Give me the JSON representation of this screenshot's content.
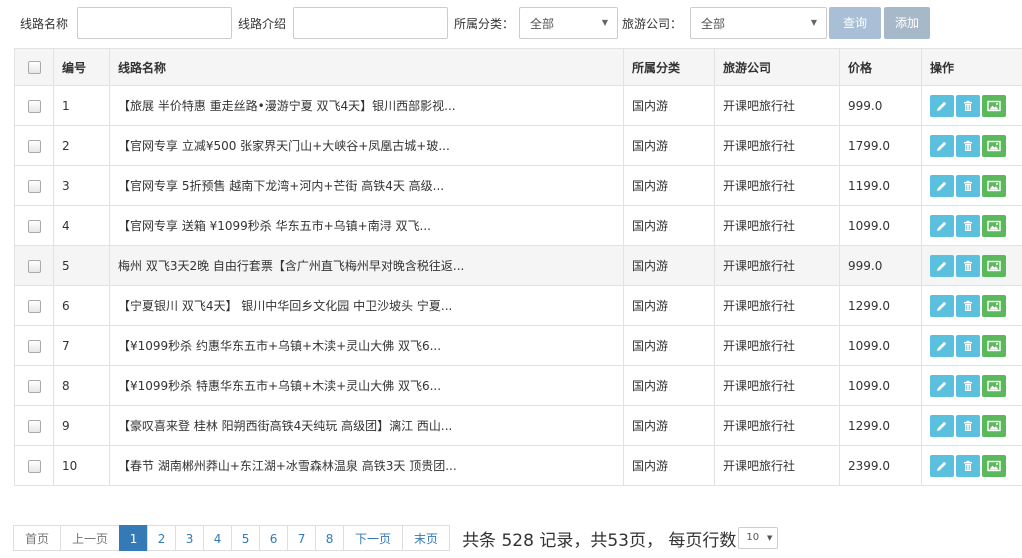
{
  "search": {
    "route_name_label": "线路名称",
    "route_name_value": "",
    "route_intro_label": "线路介绍",
    "route_intro_value": "",
    "category_label": "所属分类：",
    "category_selected": "全部",
    "company_label": "旅游公司：",
    "company_selected": "全部",
    "query_button": "查询",
    "add_button": "添加"
  },
  "table": {
    "headers": {
      "id": "编号",
      "name": "线路名称",
      "category": "所属分类",
      "company": "旅游公司",
      "price": "价格",
      "actions": "操作"
    },
    "highlighted_row": 5,
    "rows": [
      {
        "id": "1",
        "name": "【旅展 半价特惠 重走丝路•漫游宁夏 双飞4天】银川西部影视...",
        "category": "国内游",
        "company": "开课吧旅行社",
        "price": "999.0"
      },
      {
        "id": "2",
        "name": "【官网专享 立减¥500 张家界天门山+大峡谷+凤凰古城+玻...",
        "category": "国内游",
        "company": "开课吧旅行社",
        "price": "1799.0"
      },
      {
        "id": "3",
        "name": "【官网专享 5折预售 越南下龙湾+河内+芒街 高铁4天 高级...",
        "category": "国内游",
        "company": "开课吧旅行社",
        "price": "1199.0"
      },
      {
        "id": "4",
        "name": "【官网专享 送箱 ¥1099秒杀 华东五市+乌镇+南浔 双飞...",
        "category": "国内游",
        "company": "开课吧旅行社",
        "price": "1099.0"
      },
      {
        "id": "5",
        "name": "梅州 双飞3天2晚 自由行套票【含广州直飞梅州早对晚含税往返...",
        "category": "国内游",
        "company": "开课吧旅行社",
        "price": "999.0"
      },
      {
        "id": "6",
        "name": "【宁夏银川 双飞4天】 银川中华回乡文化园 中卫沙坡头 宁夏...",
        "category": "国内游",
        "company": "开课吧旅行社",
        "price": "1299.0"
      },
      {
        "id": "7",
        "name": "【¥1099秒杀 约惠华东五市+乌镇+木渎+灵山大佛 双飞6...",
        "category": "国内游",
        "company": "开课吧旅行社",
        "price": "1099.0"
      },
      {
        "id": "8",
        "name": "【¥1099秒杀 特惠华东五市+乌镇+木渎+灵山大佛 双飞6...",
        "category": "国内游",
        "company": "开课吧旅行社",
        "price": "1099.0"
      },
      {
        "id": "9",
        "name": "【豪叹喜来登 桂林 阳朔西街高铁4天纯玩 高级团】漓江 西山...",
        "category": "国内游",
        "company": "开课吧旅行社",
        "price": "1299.0"
      },
      {
        "id": "10",
        "name": "【春节 湖南郴州莽山+东江湖+冰雪森林温泉 高铁3天 顶贵团...",
        "category": "国内游",
        "company": "开课吧旅行社",
        "price": "2399.0"
      }
    ]
  },
  "pager": {
    "first": "首页",
    "prev": "上一页",
    "pages": [
      "1",
      "2",
      "3",
      "4",
      "5",
      "6",
      "7",
      "8"
    ],
    "current": "1",
    "next": "下一页",
    "last": "末页",
    "info": "共条 528 记录，共53页， 每页行数",
    "page_size": "10"
  },
  "icons": {
    "edit": "pencil-icon",
    "delete": "trash-icon",
    "image": "picture-icon"
  },
  "colors": {
    "primary": "#337ab7",
    "info": "#5bc0de",
    "success": "#5cb85c"
  }
}
